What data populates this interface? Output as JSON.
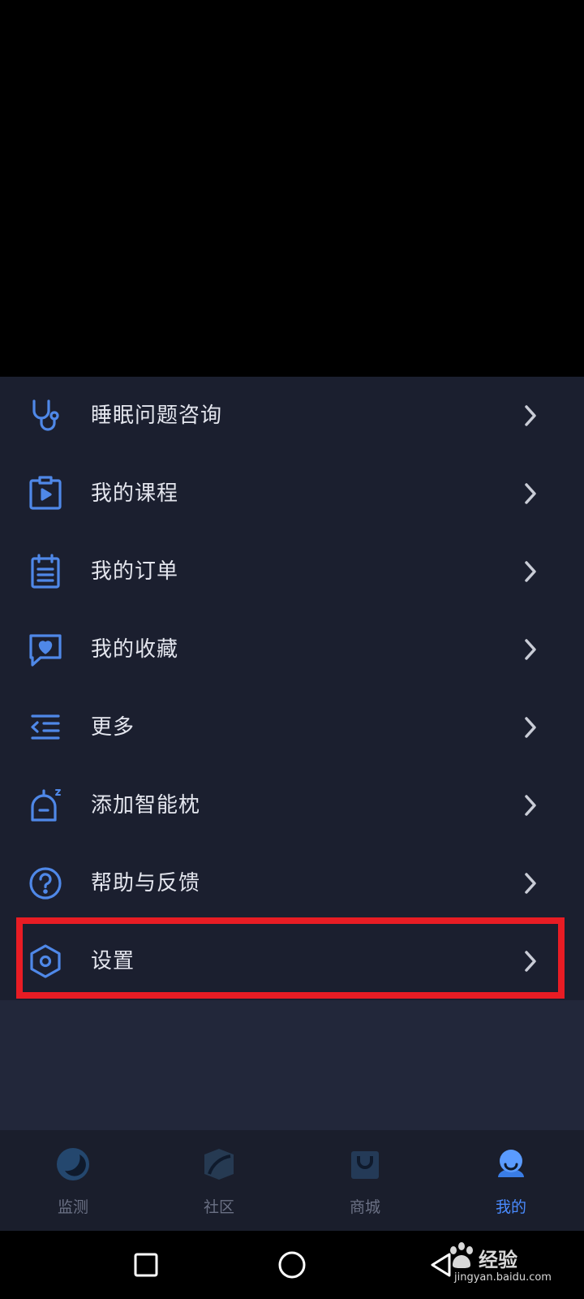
{
  "menu": {
    "items": [
      {
        "label": "睡眠问题咨询",
        "icon": "stethoscope-icon"
      },
      {
        "label": "我的课程",
        "icon": "course-clipboard-play-icon"
      },
      {
        "label": "我的订单",
        "icon": "order-list-icon"
      },
      {
        "label": "我的收藏",
        "icon": "heart-bubble-icon"
      },
      {
        "label": "更多",
        "icon": "menu-indent-icon"
      },
      {
        "label": "添加智能枕",
        "icon": "smart-pillow-icon"
      },
      {
        "label": "帮助与反馈",
        "icon": "question-circle-icon"
      },
      {
        "label": "设置",
        "icon": "hexagon-gear-icon"
      }
    ]
  },
  "tabs": [
    {
      "label": "监测",
      "active": false,
      "icon": "moon-icon"
    },
    {
      "label": "社区",
      "active": false,
      "icon": "community-icon"
    },
    {
      "label": "商城",
      "active": false,
      "icon": "shop-bag-icon"
    },
    {
      "label": "我的",
      "active": true,
      "icon": "profile-icon"
    }
  ],
  "watermark": {
    "title": "经验",
    "url": "jingyan.baidu.com"
  },
  "colors": {
    "accent": "#4a8bff",
    "icon_blue": "#4f88e8",
    "panel_bg": "#1b1f2f",
    "highlight": "#e81c24"
  }
}
